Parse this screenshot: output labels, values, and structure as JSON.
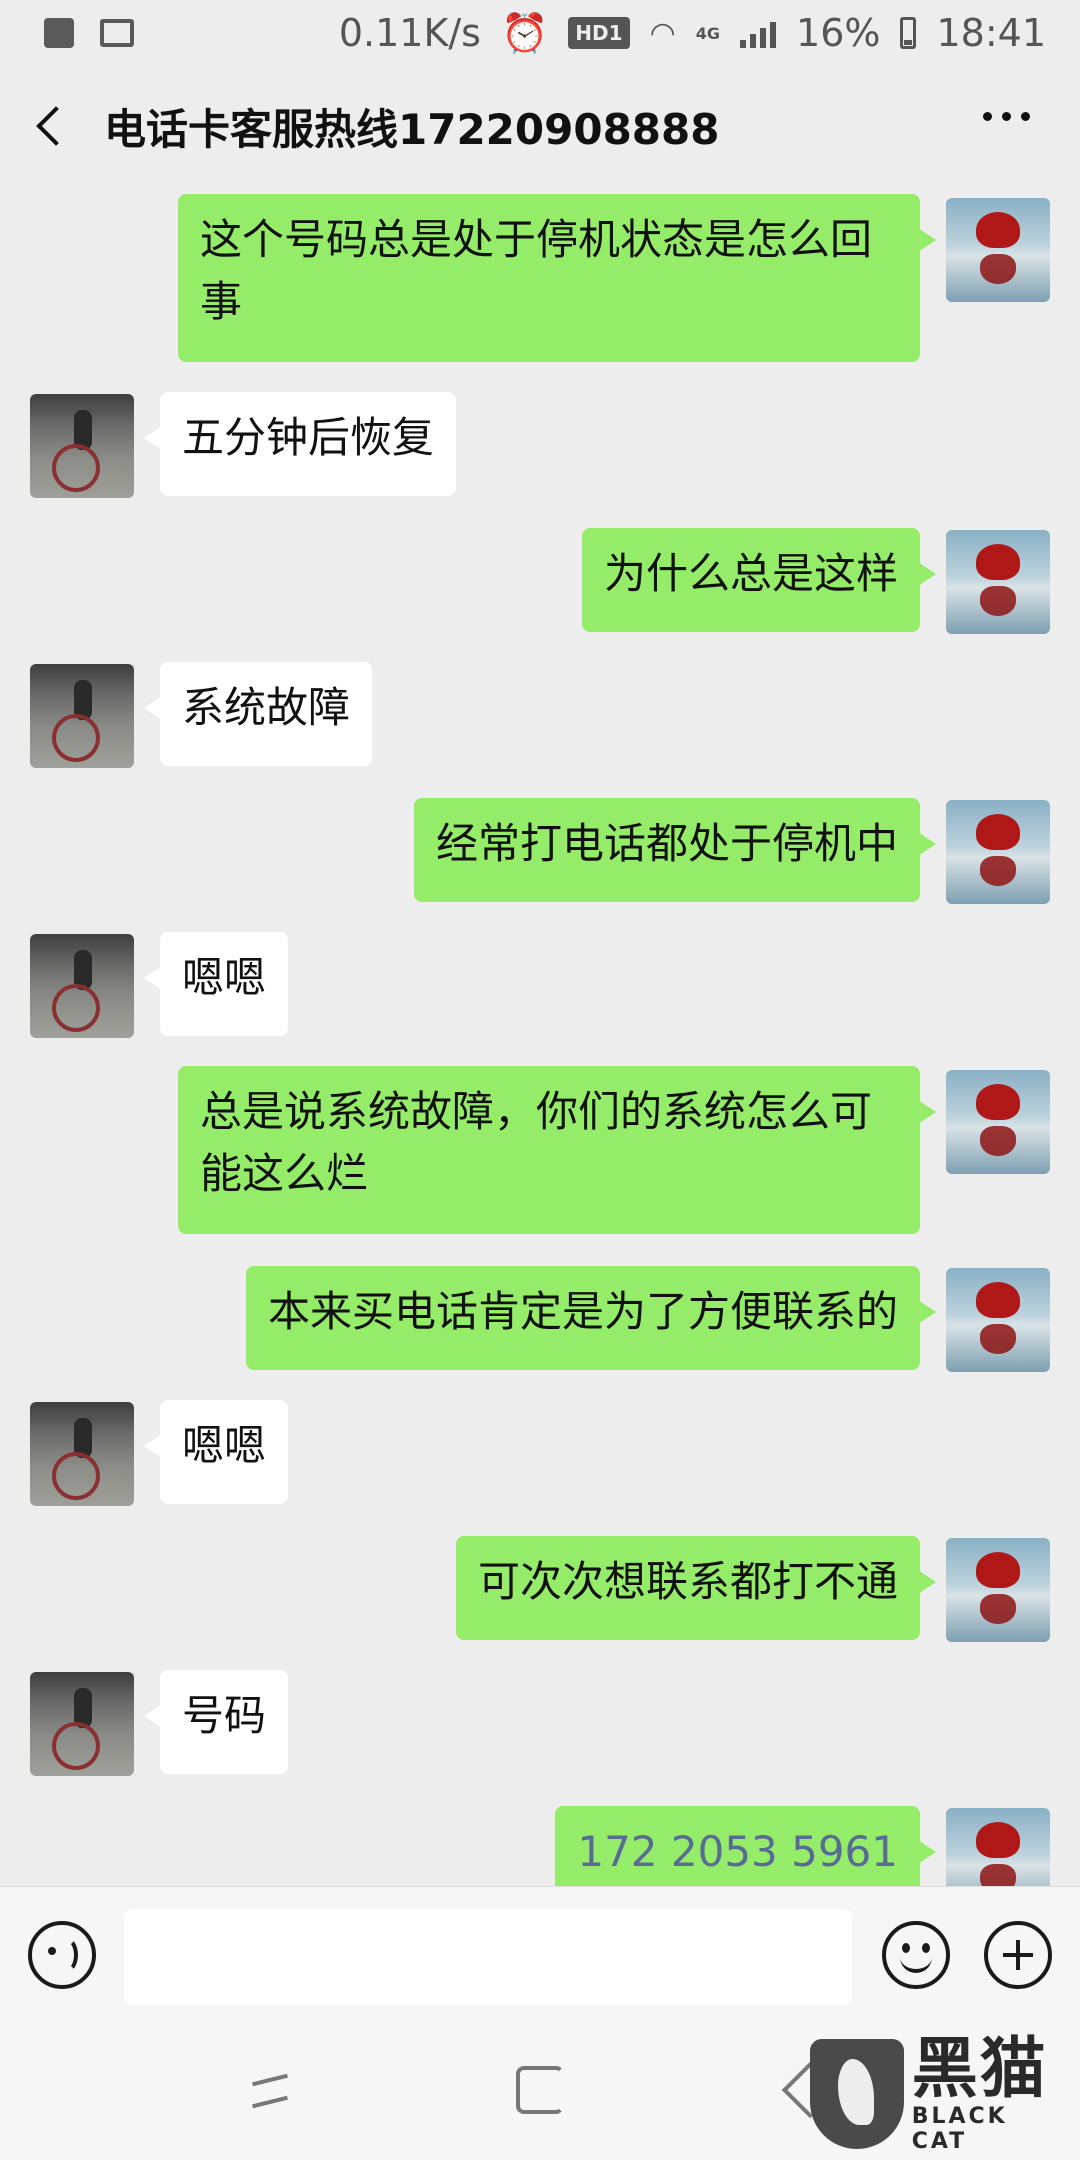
{
  "status_bar": {
    "speed": "0.11K/s",
    "hd_badge": "HD1",
    "network": "4G",
    "battery": "16%",
    "time": "18:41"
  },
  "header": {
    "title": "电话卡客服热线17220908888"
  },
  "messages": [
    {
      "sender": "me",
      "text": "这个号码总是处于停机状态是怎么回事"
    },
    {
      "sender": "other",
      "text": "五分钟后恢复"
    },
    {
      "sender": "me",
      "text": "为什么总是这样"
    },
    {
      "sender": "other",
      "text": "系统故障"
    },
    {
      "sender": "me",
      "text": "经常打电话都处于停机中"
    },
    {
      "sender": "other",
      "text": "嗯嗯"
    },
    {
      "sender": "me",
      "text": "总是说系统故障，你们的系统怎么可能这么烂"
    },
    {
      "sender": "me",
      "text": "本来买电话肯定是为了方便联系的"
    },
    {
      "sender": "other",
      "text": "嗯嗯"
    },
    {
      "sender": "me",
      "text": "可次次想联系都打不通"
    },
    {
      "sender": "other",
      "text": "号码"
    },
    {
      "sender": "me",
      "text": "172 2053 5961"
    }
  ],
  "input": {
    "value": ""
  },
  "watermark": {
    "cn": "黑猫",
    "en": "BLACK CAT"
  },
  "colors": {
    "my_bubble": "#95ec69",
    "other_bubble": "#ffffff",
    "background": "#ededed",
    "phone_link": "#576b95"
  }
}
